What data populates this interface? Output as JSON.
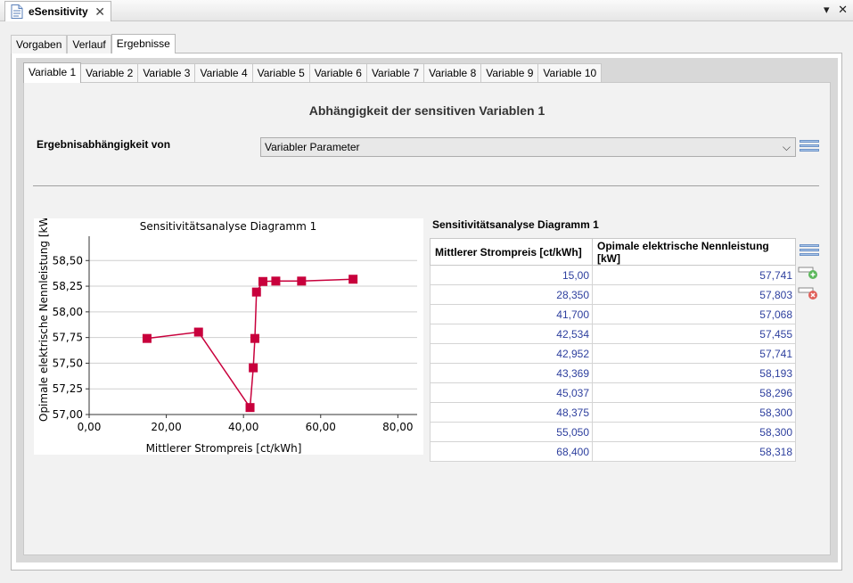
{
  "window": {
    "title": "eSensitivity",
    "controls": [
      "▾",
      "✕"
    ]
  },
  "outer_tabs": [
    {
      "label": "Vorgaben",
      "active": false
    },
    {
      "label": "Verlauf",
      "active": false
    },
    {
      "label": "Ergebnisse",
      "active": true
    }
  ],
  "inner_tabs": [
    {
      "label": "Variable 1",
      "active": true
    },
    {
      "label": "Variable 2",
      "active": false
    },
    {
      "label": "Variable 3",
      "active": false
    },
    {
      "label": "Variable 4",
      "active": false
    },
    {
      "label": "Variable 5",
      "active": false
    },
    {
      "label": "Variable 6",
      "active": false
    },
    {
      "label": "Variable 7",
      "active": false
    },
    {
      "label": "Variable 8",
      "active": false
    },
    {
      "label": "Variable 9",
      "active": false
    },
    {
      "label": "Variable 10",
      "active": false
    }
  ],
  "section_title": "Abhängigkeit der sensitiven Variablen 1",
  "dependency": {
    "label": "Ergebnisabhängigkeit von",
    "selected": "Variabler Parameter"
  },
  "table": {
    "title": "Sensitivitätsanalyse Diagramm 1",
    "headers": [
      "Mittlerer Strompreis  [ct/kWh]",
      "Opimale elektrische Nennleistung [kW]"
    ],
    "rows": [
      [
        "15,00",
        "57,741"
      ],
      [
        "28,350",
        "57,803"
      ],
      [
        "41,700",
        "57,068"
      ],
      [
        "42,534",
        "57,455"
      ],
      [
        "42,952",
        "57,741"
      ],
      [
        "43,369",
        "58,193"
      ],
      [
        "45,037",
        "58,296"
      ],
      [
        "48,375",
        "58,300"
      ],
      [
        "55,050",
        "58,300"
      ],
      [
        "68,400",
        "58,318"
      ]
    ]
  },
  "chart_data": {
    "type": "line",
    "title": "Sensitivitätsanalyse Diagramm 1",
    "xlabel": "Mittlerer Strompreis  [ct/kWh]",
    "ylabel": "Opimale elektrische Nennleistung [kW",
    "x": [
      15.0,
      28.35,
      41.7,
      42.534,
      42.952,
      43.369,
      45.037,
      48.375,
      55.05,
      68.4
    ],
    "y": [
      57.741,
      57.803,
      57.068,
      57.455,
      57.741,
      58.193,
      58.296,
      58.3,
      58.3,
      58.318
    ],
    "xlim": [
      0,
      85
    ],
    "ylim": [
      57.0,
      58.65
    ],
    "xticks": [
      "0,00",
      "20,00",
      "40,00",
      "60,00",
      "80,00"
    ],
    "yticks": [
      "57,00",
      "57,25",
      "57,50",
      "57,75",
      "58,00",
      "58,25",
      "58,50"
    ],
    "grid": true,
    "color": "#c8003c"
  },
  "colors": {
    "accent": "#c8003c",
    "table_value": "#2d3f9e"
  },
  "icons": [
    "document-icon",
    "close-icon",
    "list-icon",
    "add-row-icon",
    "remove-row-icon"
  ]
}
